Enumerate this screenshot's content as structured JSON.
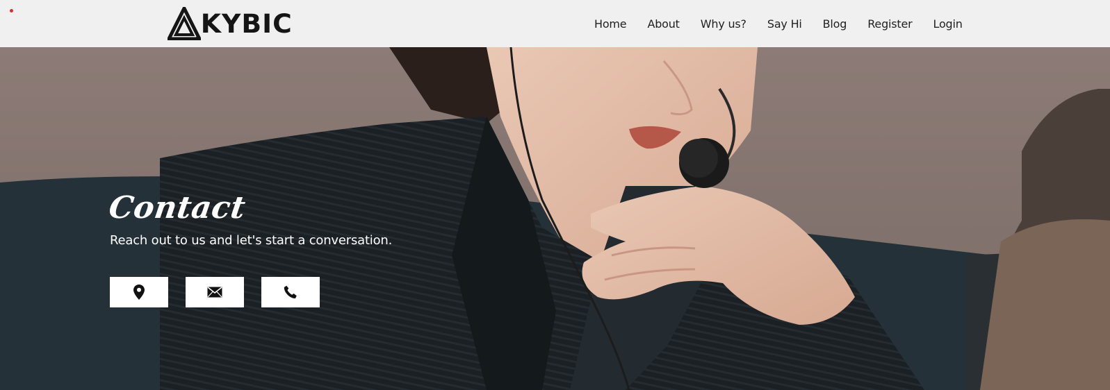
{
  "header": {
    "logo_text": "KYBIC",
    "nav": [
      {
        "label": "Home"
      },
      {
        "label": "About"
      },
      {
        "label": "Why us?"
      },
      {
        "label": "Say Hi"
      },
      {
        "label": "Blog"
      },
      {
        "label": "Register"
      },
      {
        "label": "Login"
      }
    ]
  },
  "hero": {
    "title": "Contact",
    "subtitle": "Reach out to us and let's start a conversation.",
    "buttons": [
      {
        "icon": "location-pin-icon"
      },
      {
        "icon": "envelope-icon"
      },
      {
        "icon": "phone-icon"
      }
    ]
  },
  "colors": {
    "header_bg": "#f0f0f0",
    "text_dark": "#1f1f1f",
    "accent_dot": "#d9302c",
    "button_bg": "#ffffff"
  }
}
